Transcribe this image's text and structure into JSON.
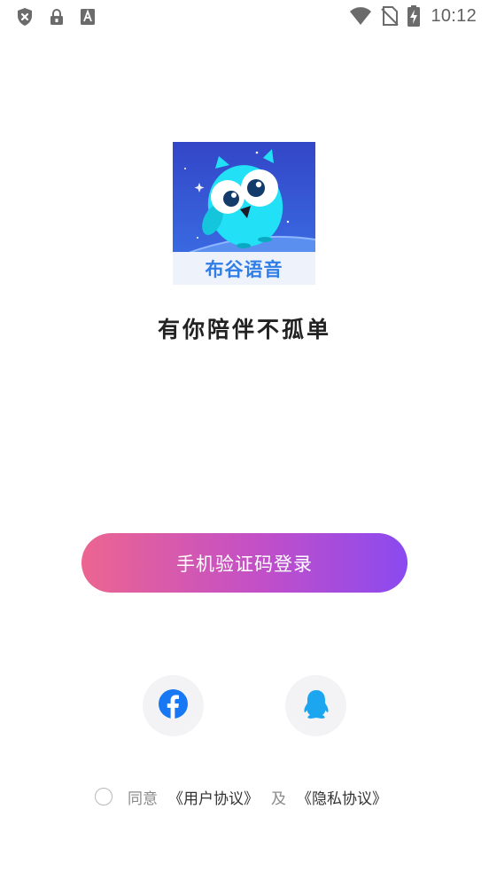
{
  "status_bar": {
    "time": "10:12",
    "left_icons": [
      "shield-x-icon",
      "lock-icon",
      "keyboard-a-icon"
    ],
    "right_icons": [
      "wifi-icon",
      "no-sim-icon",
      "battery-charging-icon"
    ]
  },
  "app": {
    "logo_text": "布谷语音",
    "slogan": "有你陪伴不孤单"
  },
  "login": {
    "phone_button_label": "手机验证码登录",
    "third_party": [
      {
        "name": "facebook",
        "icon": "facebook-icon",
        "color": "#1877f2"
      },
      {
        "name": "qq",
        "icon": "qq-icon",
        "color": "#1ca6f0"
      }
    ]
  },
  "agreement": {
    "checked": false,
    "agree_label": "同意",
    "user_agreement": "《用户协议》",
    "and_label": "及",
    "privacy_policy": "《隐私协议》"
  },
  "colors": {
    "button_gradient_start": "#ec6590",
    "button_gradient_end": "#8a4af0",
    "logo_background": "#3a5bd8",
    "owl_body": "#22e0f5"
  }
}
